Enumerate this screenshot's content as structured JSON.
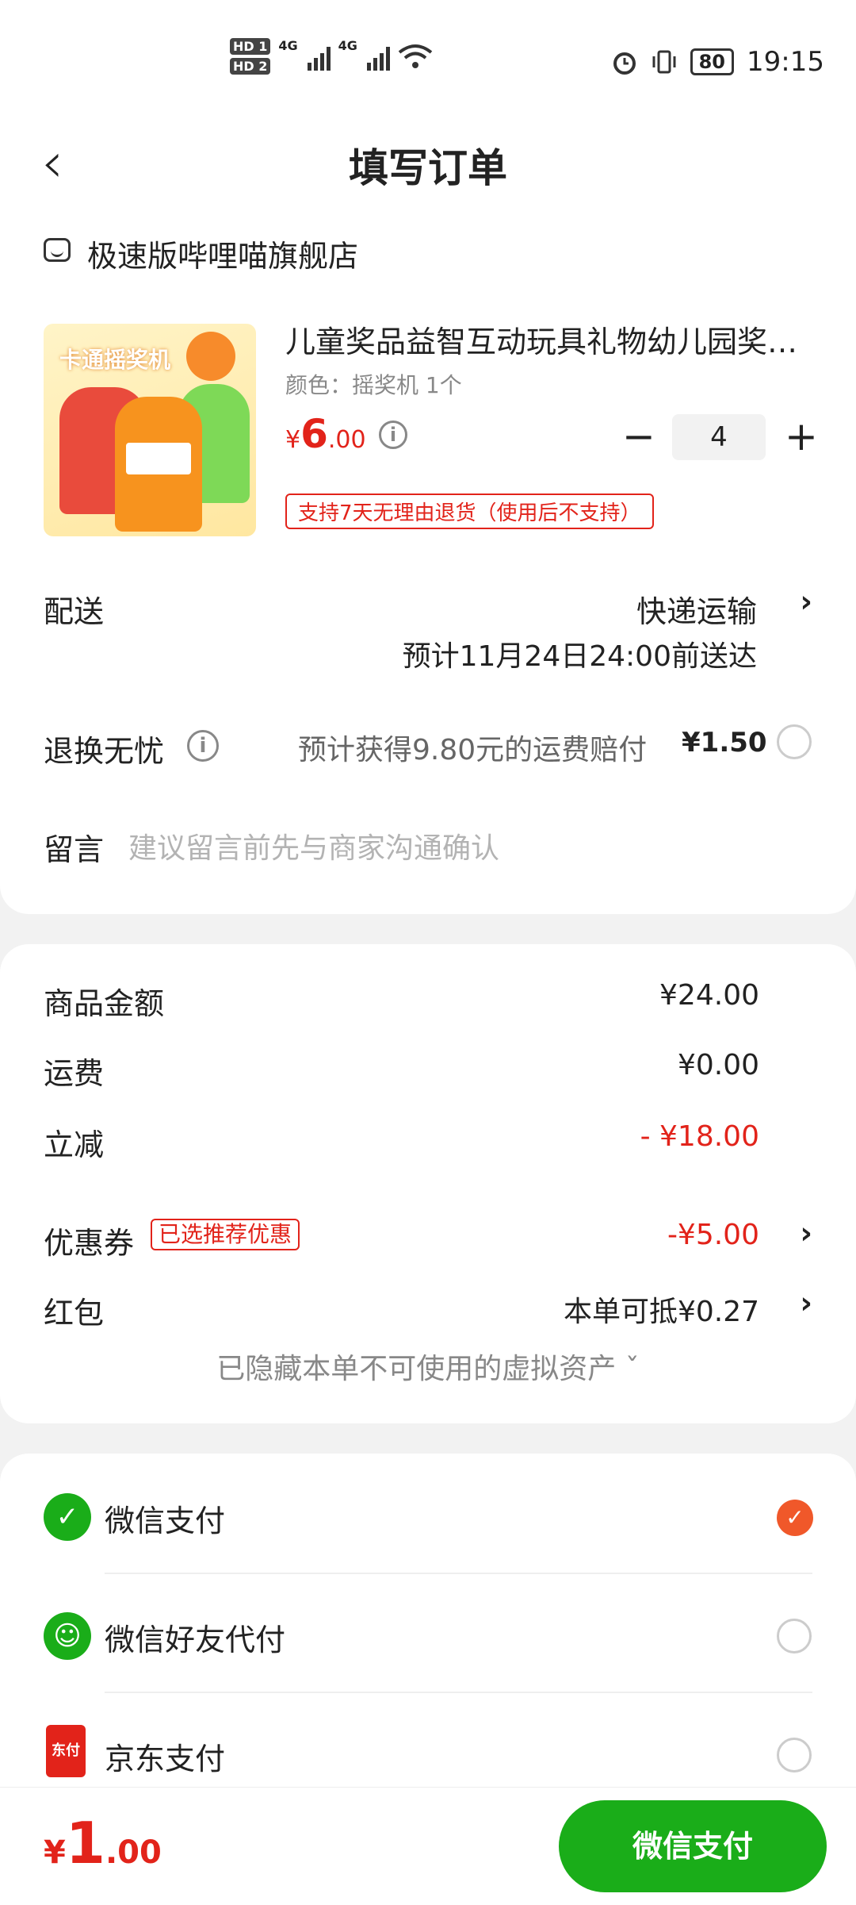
{
  "status_bar": {
    "hd1": "HD 1",
    "hd2": "HD 2",
    "net1": "4G",
    "net2": "4G",
    "battery": "80",
    "time": "19:15"
  },
  "header": {
    "back_icon": "chevron-left-icon",
    "title": "填写订单"
  },
  "store": {
    "icon": "store-icon",
    "name": "极速版哔哩喵旗舰店"
  },
  "product": {
    "image_text": "卡通摇奖机",
    "title": "儿童奖品益智互动玩具礼物幼儿园奖…",
    "spec": "颜色：摇奖机 1个",
    "currency": "¥",
    "price_int": "6",
    "price_dec": ".00",
    "quantity": "4",
    "minus": "−",
    "plus": "+",
    "return_policy": "支持7天无理由退货（使用后不支持）"
  },
  "delivery": {
    "label": "配送",
    "method": "快递运输",
    "eta": "预计11月24日24:00前送达"
  },
  "worry_free": {
    "label": "退换无忧",
    "description": "预计获得9.80元的运费赔付",
    "price": "¥1.50"
  },
  "message": {
    "label": "留言",
    "placeholder": "建议留言前先与商家沟通确认"
  },
  "summary": {
    "goods_label": "商品金额",
    "goods_value": "¥24.00",
    "shipping_label": "运费",
    "shipping_value": "¥0.00",
    "discount_label": "立减",
    "discount_value": "- ¥18.00",
    "coupon_label": "优惠券",
    "coupon_tag": "已选推荐优惠",
    "coupon_value": "-¥5.00",
    "redpacket_label": "红包",
    "redpacket_value": "本单可抵¥0.27",
    "hidden_assets": "已隐藏本单不可使用的虚拟资产 ˇ"
  },
  "payment": {
    "methods": [
      {
        "label": "微信支付",
        "selected": true,
        "icon": "wechat-pay-icon"
      },
      {
        "label": "微信好友代付",
        "selected": false,
        "icon": "wechat-friend-pay-icon"
      },
      {
        "label": "京东支付",
        "selected": false,
        "icon": "jd-pay-icon",
        "icon_text": "东付"
      }
    ]
  },
  "bottom": {
    "currency": "¥",
    "total_int": "1",
    "total_dec": ".00",
    "pay_button": "微信支付"
  },
  "colors": {
    "accent_red": "#e2231a",
    "wechat_green": "#1aad19",
    "check_orange": "#f0582a"
  }
}
